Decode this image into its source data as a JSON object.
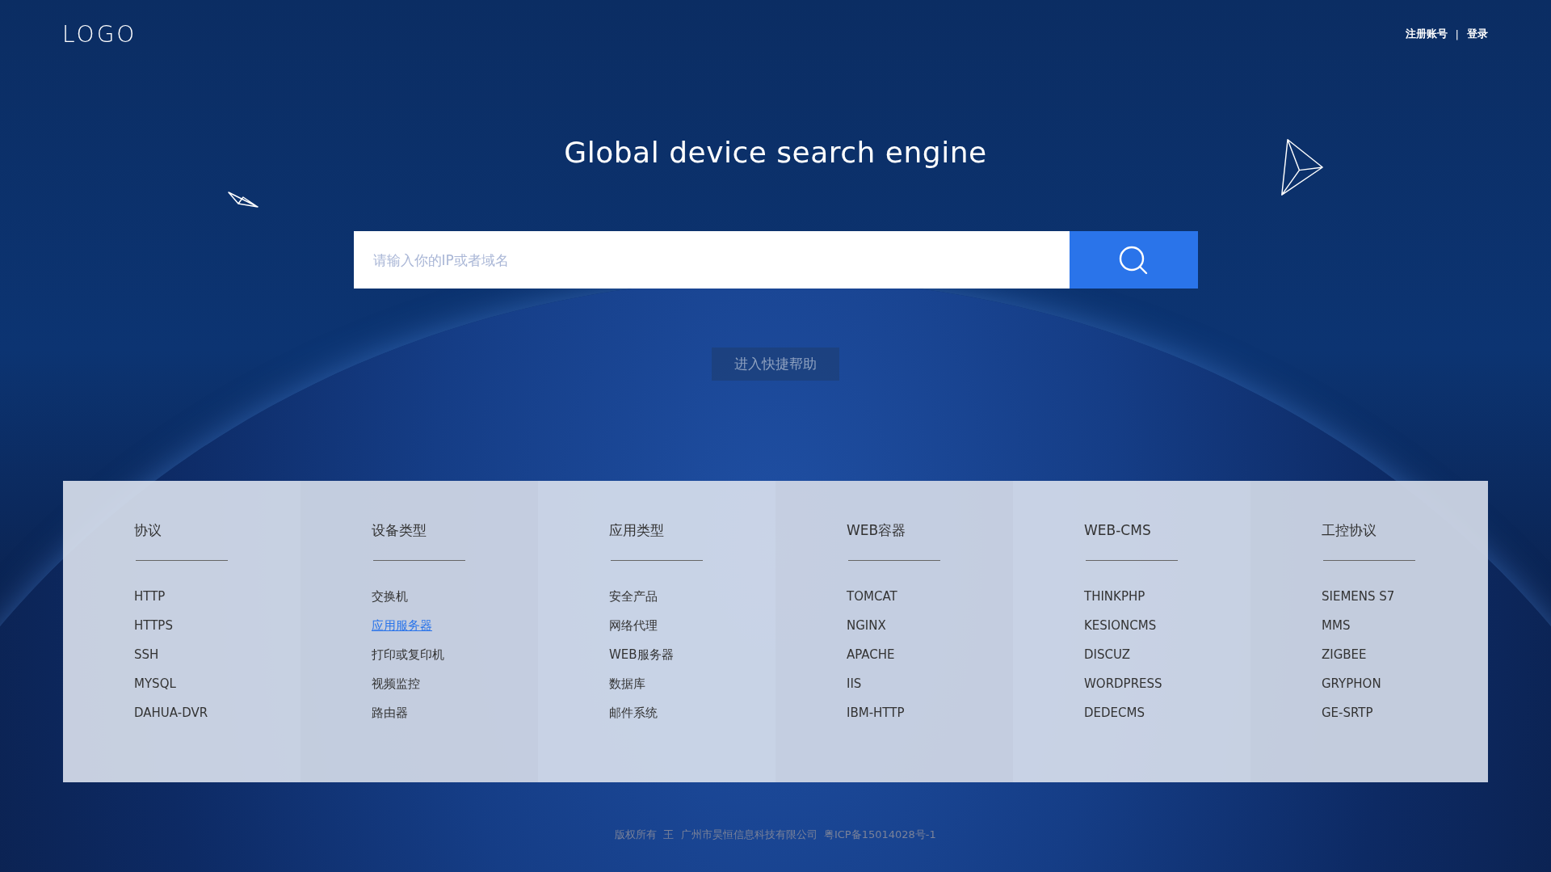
{
  "header": {
    "logo": "LOGO",
    "links": [
      {
        "label": "注册账号"
      },
      {
        "label": "登录"
      }
    ],
    "separator": "|"
  },
  "hero": {
    "title": "Global device search engine"
  },
  "search": {
    "placeholder": "请输入你的IP或者域名"
  },
  "help_button": {
    "label": "进入快捷帮助"
  },
  "categories": [
    {
      "title": "协议",
      "items": [
        {
          "label": "HTTP",
          "selected": false
        },
        {
          "label": "HTTPS",
          "selected": false
        },
        {
          "label": "SSH",
          "selected": false
        },
        {
          "label": "MYSQL",
          "selected": false
        },
        {
          "label": "DAHUA-DVR",
          "selected": false
        }
      ]
    },
    {
      "title": "设备类型",
      "items": [
        {
          "label": "交换机",
          "selected": false
        },
        {
          "label": "应用服务器",
          "selected": true
        },
        {
          "label": "打印或复印机",
          "selected": false
        },
        {
          "label": "视频监控",
          "selected": false
        },
        {
          "label": "路由器",
          "selected": false
        }
      ]
    },
    {
      "title": "应用类型",
      "items": [
        {
          "label": "安全产品",
          "selected": false
        },
        {
          "label": "网络代理",
          "selected": false
        },
        {
          "label": "WEB服务器",
          "selected": false
        },
        {
          "label": "数据库",
          "selected": false
        },
        {
          "label": "邮件系统",
          "selected": false
        }
      ]
    },
    {
      "title": "WEB容器",
      "items": [
        {
          "label": "TOMCAT",
          "selected": false
        },
        {
          "label": "NGINX",
          "selected": false
        },
        {
          "label": "APACHE",
          "selected": false
        },
        {
          "label": "IIS",
          "selected": false
        },
        {
          "label": "IBM-HTTP",
          "selected": false
        }
      ]
    },
    {
      "title": "WEB-CMS",
      "items": [
        {
          "label": "THINKPHP",
          "selected": false
        },
        {
          "label": "KESIONCMS",
          "selected": false
        },
        {
          "label": "DISCUZ",
          "selected": false
        },
        {
          "label": "WORDPRESS",
          "selected": false
        },
        {
          "label": "DEDECMS",
          "selected": false
        }
      ]
    },
    {
      "title": "工控协议",
      "items": [
        {
          "label": "SIEMENS S7",
          "selected": false
        },
        {
          "label": "MMS",
          "selected": false
        },
        {
          "label": "ZIGBEE",
          "selected": false
        },
        {
          "label": "GRYPHON",
          "selected": false
        },
        {
          "label": "GE-SRTP",
          "selected": false
        }
      ]
    }
  ],
  "footer": {
    "text": "版权所有  王  广州市昊恒信息科技有限公司  粤ICP备15014028号-1"
  }
}
